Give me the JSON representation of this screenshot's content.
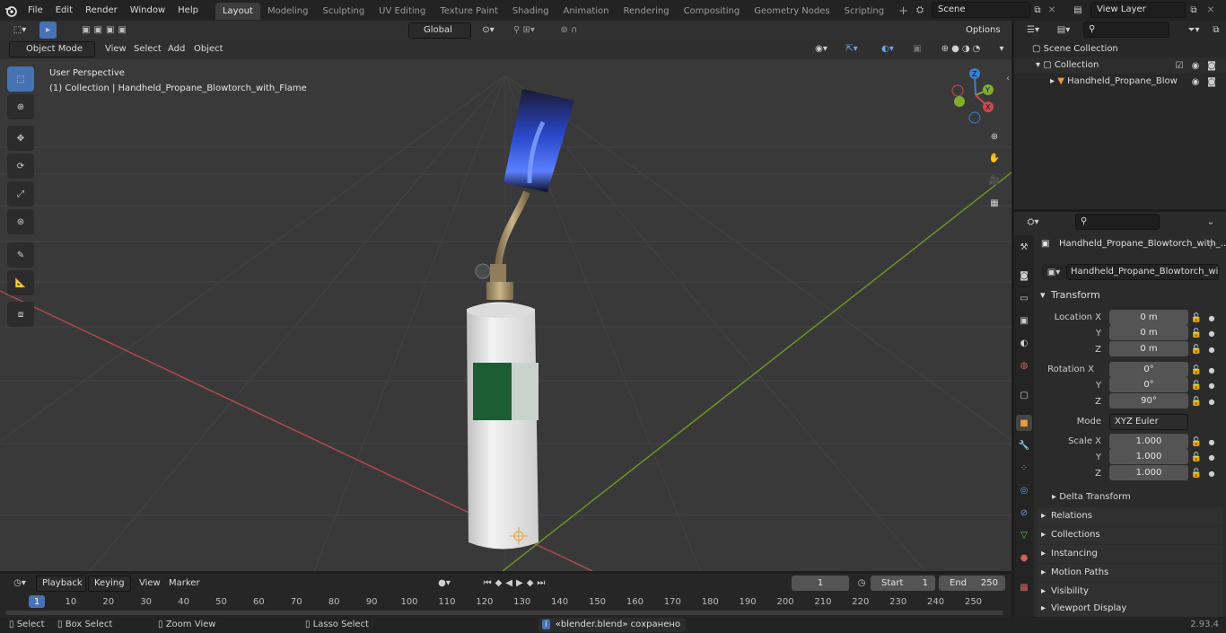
{
  "topbar": {
    "menus": [
      "File",
      "Edit",
      "Render",
      "Window",
      "Help"
    ],
    "workspaces": [
      "Layout",
      "Modeling",
      "Sculpting",
      "UV Editing",
      "Texture Paint",
      "Shading",
      "Animation",
      "Rendering",
      "Compositing",
      "Geometry Nodes",
      "Scripting"
    ],
    "active_workspace": "Layout",
    "scene": "Scene",
    "view_layer": "View Layer"
  },
  "viewport_header": {
    "transform_orientation": "Global",
    "options_label": "Options",
    "mode": "Object Mode",
    "menus": [
      "View",
      "Select",
      "Add",
      "Object"
    ]
  },
  "viewport": {
    "perspective_label": "User Perspective",
    "collection_label": "(1) Collection | Handheld_Propane_Blowtorch_with_Flame",
    "gizmo": {
      "x": "X",
      "y": "Y",
      "z": "Z"
    },
    "colors": {
      "x_axis": "#c9494f",
      "y_axis": "#7fad2e",
      "z_axis": "#3a7fd3",
      "flame": "#3f6dff",
      "bg": "#393939",
      "grid": "#474747"
    }
  },
  "outliner": {
    "scene_collection": "Scene Collection",
    "collection": "Collection",
    "object": "Handheld_Propane_Blow"
  },
  "properties": {
    "object_name": "Handheld_Propane_Blowtorch_with_...",
    "datablock_name": "Handheld_Propane_Blowtorch_with_Fla...",
    "transform_title": "Transform",
    "location_label": "Location X",
    "rotation_label": "Rotation X",
    "scale_label": "Scale X",
    "y_label": "Y",
    "z_label": "Z",
    "location": [
      "0 m",
      "0 m",
      "0 m"
    ],
    "rotation": [
      "0°",
      "0°",
      "90°"
    ],
    "mode_label": "Mode",
    "mode_value": "XYZ Euler",
    "scale": [
      "1.000",
      "1.000",
      "1.000"
    ],
    "delta_transform": "Delta Transform",
    "sections": [
      "Relations",
      "Collections",
      "Instancing",
      "Motion Paths",
      "Visibility",
      "Viewport Display"
    ]
  },
  "timeline": {
    "menus": [
      "Playback",
      "Keying",
      "View",
      "Marker"
    ],
    "current_frame": "1",
    "start_label": "Start",
    "start": "1",
    "end_label": "End",
    "end": "250",
    "ticks": [
      "1",
      "10",
      "20",
      "30",
      "40",
      "50",
      "60",
      "70",
      "80",
      "90",
      "100",
      "110",
      "120",
      "130",
      "140",
      "150",
      "160",
      "170",
      "180",
      "190",
      "200",
      "210",
      "220",
      "230",
      "240",
      "250"
    ]
  },
  "statusbar": {
    "select": "Select",
    "box_select": "Box Select",
    "zoom_view": "Zoom View",
    "lasso_select": "Lasso Select",
    "message": "«blender.blend» сохранено",
    "version": "2.93.4"
  }
}
